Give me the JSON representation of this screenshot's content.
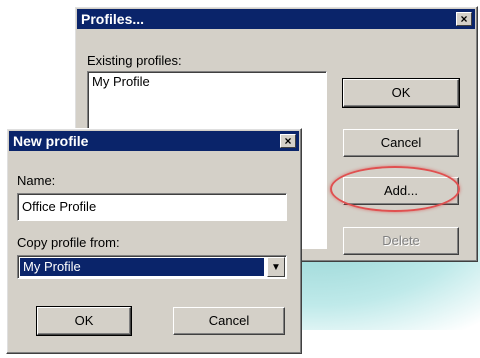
{
  "profiles_dialog": {
    "title": "Profiles...",
    "existing_label": "Existing profiles:",
    "profiles": [
      "My Profile"
    ],
    "ok_label": "OK",
    "cancel_label": "Cancel",
    "add_label": "Add...",
    "delete_label": "Delete",
    "close_glyph": "×"
  },
  "new_profile_dialog": {
    "title": "New profile",
    "name_label": "Name:",
    "name_value": "Office Profile",
    "copy_label": "Copy profile from:",
    "copy_selected": "My Profile",
    "ok_label": "OK",
    "cancel_label": "Cancel",
    "close_glyph": "×",
    "dropdown_glyph": "▼"
  },
  "colors": {
    "titlebar": "#0a246a",
    "dialog_face": "#d4d0c8",
    "highlight_ellipse": "#e05050"
  }
}
